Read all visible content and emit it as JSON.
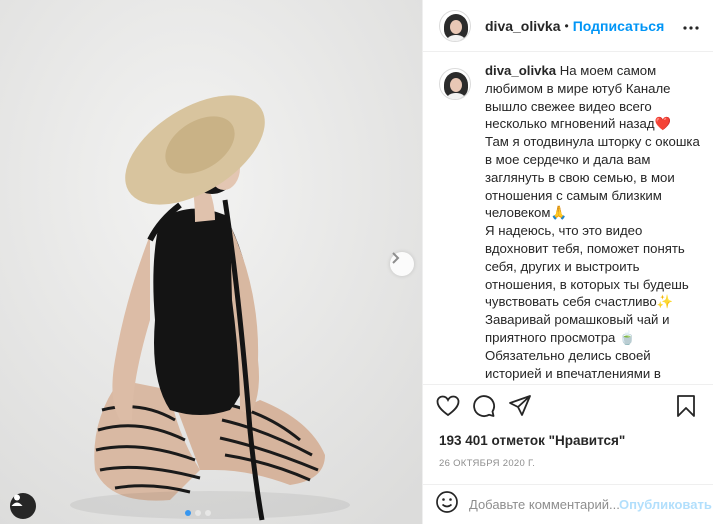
{
  "post": {
    "username": "diva_olivka",
    "separator": "•",
    "follow_label": "Подписаться",
    "caption": "На моем самом любимом в мире ютуб Канале вышло свежее видео всего несколько мгновений назад❤️\nТам я отодвинула шторку с окошка в мое сердечко и дала вам заглянуть в свою семью, в мои отношения с самым близким человеком🙏\nЯ надеюсь, что это видео вдохновит тебя, поможет понять себя, других и выстроить отношения, в которых ты будешь чувствовать себя счастливо✨\nЗаваривай ромашковый чай и приятного просмотра 🍵\nОбязательно делись своей историей и впечатлениями в комментариях, мне это очень важно!\nСсылка на видео в шапке моего профиля👍 Канал называется Diva Olivka, если ты захочешь",
    "likes": "193 401 отметок \"Нравится\"",
    "date": "26 ОКТЯБРЯ 2020 Г."
  },
  "comment": {
    "placeholder": "Добавьте комментарий...",
    "publish_label": "Опубликовать"
  },
  "colors": {
    "accent": "#0095f6",
    "publish_disabled": "#b2dffc",
    "carousel_active": "#3897f0"
  },
  "carousel": {
    "slides": 3,
    "active": 1
  }
}
